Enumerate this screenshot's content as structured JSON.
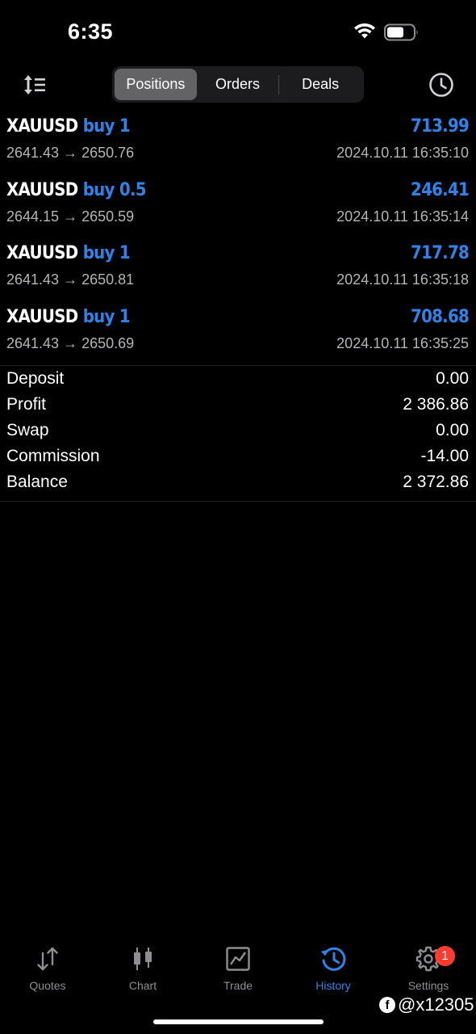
{
  "status_bar": {
    "time": "6:35"
  },
  "header": {
    "tabs": [
      {
        "label": "Positions",
        "active": true
      },
      {
        "label": "Orders",
        "active": false
      },
      {
        "label": "Deals",
        "active": false
      }
    ],
    "sort_icon": "sort-icon",
    "history_icon": "clock-icon"
  },
  "positions": [
    {
      "symbol": "XAUUSD",
      "type": "buy 1",
      "profit": "713.99",
      "prices": "2641.43 → 2650.76",
      "time": "2024.10.11 16:35:10"
    },
    {
      "symbol": "XAUUSD",
      "type": "buy 0.5",
      "profit": "246.41",
      "prices": "2644.15 → 2650.59",
      "time": "2024.10.11 16:35:14"
    },
    {
      "symbol": "XAUUSD",
      "type": "buy 1",
      "profit": "717.78",
      "prices": "2641.43 → 2650.81",
      "time": "2024.10.11 16:35:18"
    },
    {
      "symbol": "XAUUSD",
      "type": "buy 1",
      "profit": "708.68",
      "prices": "2641.43 → 2650.69",
      "time": "2024.10.11 16:35:25"
    }
  ],
  "summary": [
    {
      "label": "Deposit",
      "value": "0.00"
    },
    {
      "label": "Profit",
      "value": "2 386.86"
    },
    {
      "label": "Swap",
      "value": "0.00"
    },
    {
      "label": "Commission",
      "value": "-14.00"
    },
    {
      "label": "Balance",
      "value": "2 372.86"
    }
  ],
  "tabbar": {
    "items": [
      {
        "label": "Quotes",
        "icon": "quotes-icon",
        "active": false
      },
      {
        "label": "Chart",
        "icon": "chart-icon",
        "active": false
      },
      {
        "label": "Trade",
        "icon": "trade-icon",
        "active": false
      },
      {
        "label": "History",
        "icon": "history-icon",
        "active": true
      },
      {
        "label": "Settings",
        "icon": "gear-icon",
        "active": false,
        "badge": "1"
      }
    ]
  },
  "watermark": {
    "text": "@x12305"
  },
  "colors": {
    "accent": "#2f83e8",
    "background": "#000000",
    "badge": "#ff3b30"
  }
}
